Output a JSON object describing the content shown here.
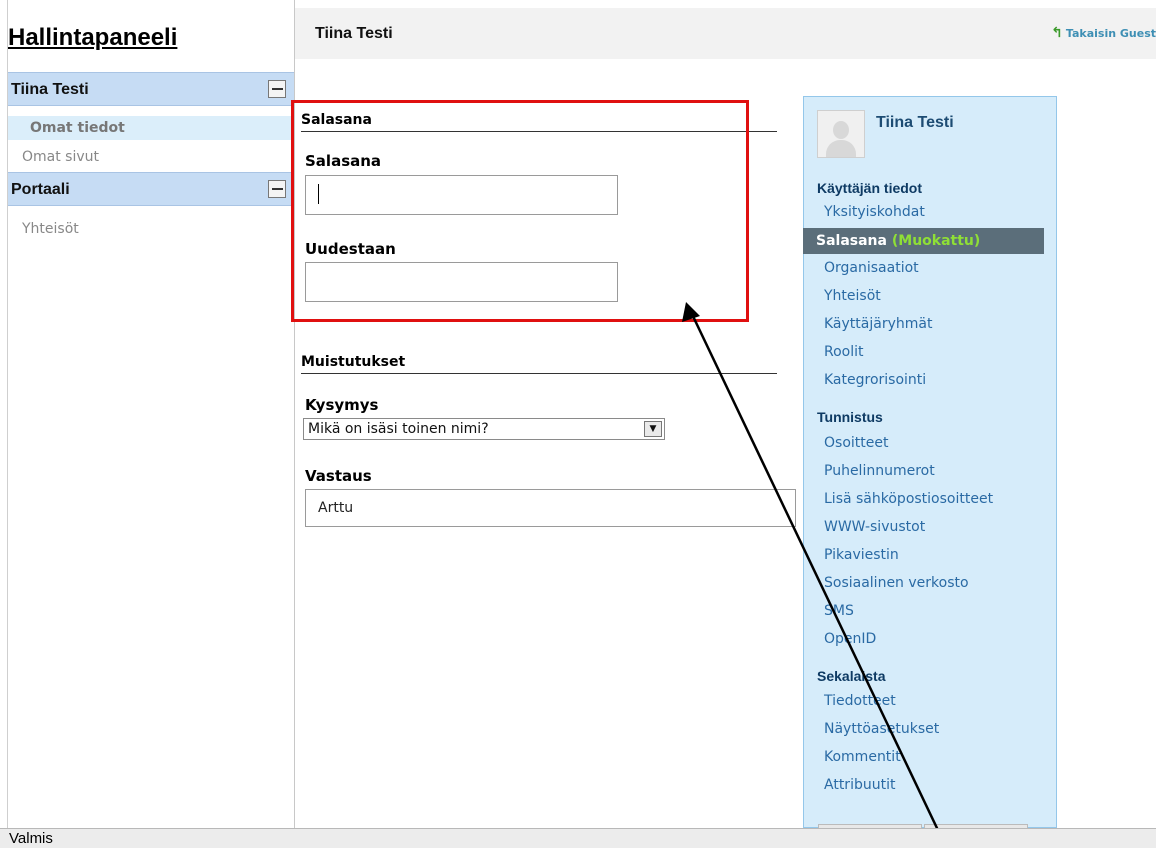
{
  "sidebar": {
    "title": "Hallintapaneeli",
    "sections": [
      {
        "label": "Tiina Testi",
        "items": [
          "Omat tiedot",
          "Omat sivut"
        ],
        "active_item": "Omat tiedot"
      },
      {
        "label": "Portaali",
        "items": [
          "Yhteisöt"
        ]
      }
    ]
  },
  "header": {
    "title": "Tiina Testi",
    "back_link": "Takaisin Guest"
  },
  "form": {
    "password_section": "Salasana",
    "password_label": "Salasana",
    "password_value": "",
    "repeat_label": "Uudestaan",
    "repeat_value": "",
    "reminders_section": "Muistutukset",
    "question_label": "Kysymys",
    "question_value": "Mikä on isäsi toinen nimi?",
    "answer_label": "Vastaus",
    "answer_value": "Arttu"
  },
  "profile_panel": {
    "name": "Tiina Testi",
    "groups": [
      {
        "title": "Käyttäjän tiedot",
        "links": [
          "Yksityiskohdat",
          "Salasana",
          "Organisaatiot",
          "Yhteisöt",
          "Käyttäjäryhmät",
          "Roolit",
          "Kategrorisointi"
        ]
      },
      {
        "title": "Tunnistus",
        "links": [
          "Osoitteet",
          "Puhelinnumerot",
          "Lisä sähköpostiosoitteet",
          "WWW-sivustot",
          "Pikaviestin",
          "Sosiaalinen verkosto",
          "SMS",
          "OpenID"
        ]
      },
      {
        "title": "Sekalaista",
        "links": [
          "Tiedotteet",
          "Näyttöasetukset",
          "Kommentit",
          "Attribuutit"
        ]
      }
    ],
    "active_link": "Salasana",
    "active_suffix": "(Muokattu)"
  },
  "status_bar": {
    "text": "Valmis"
  },
  "colors": {
    "highlight_box": "#e01010",
    "panel_bg": "#d6ecfa",
    "active_link_bg": "#5b6e7a",
    "modified_text": "#8fdf36"
  }
}
